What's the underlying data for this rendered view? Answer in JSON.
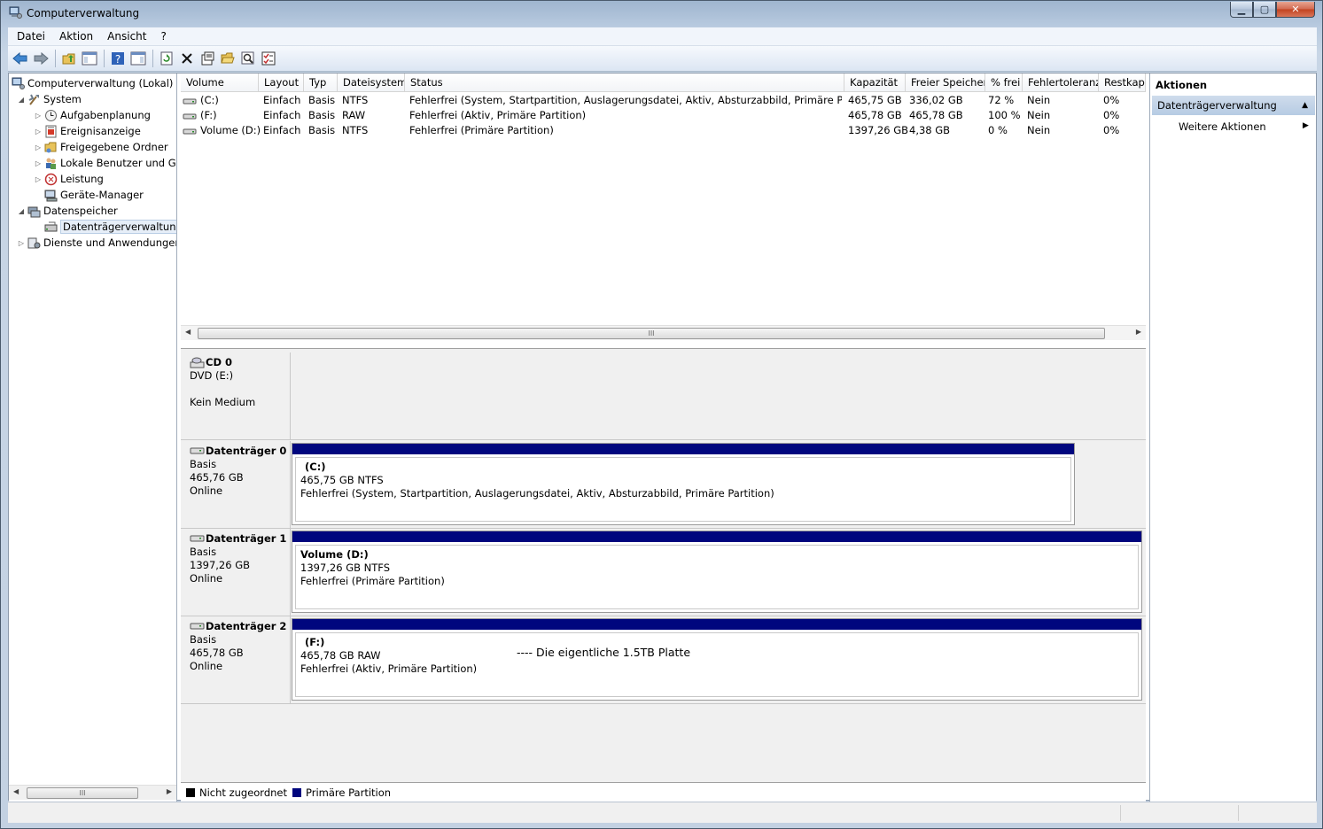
{
  "window": {
    "title": "Computerverwaltung"
  },
  "menu": [
    "Datei",
    "Aktion",
    "Ansicht",
    "?"
  ],
  "tree": {
    "root": "Computerverwaltung (Lokal)",
    "system": "System",
    "aufgaben": "Aufgabenplanung",
    "ereignis": "Ereignisanzeige",
    "freigegeben": "Freigegebene Ordner",
    "benutzer": "Lokale Benutzer und Gr",
    "leistung": "Leistung",
    "geraete": "Geräte-Manager",
    "speicher": "Datenspeicher",
    "datentraeger": "Datenträgerverwaltung",
    "dienste": "Dienste und Anwendungen",
    "scroll_thumb": "III"
  },
  "list": {
    "headers": [
      "Volume",
      "Layout",
      "Typ",
      "Dateisystem",
      "Status",
      "Kapazität",
      "Freier Speicher",
      "% frei",
      "Fehlertoleranz",
      "Restkapa"
    ],
    "rows": [
      [
        "(C:)",
        "Einfach",
        "Basis",
        "NTFS",
        "Fehlerfrei (System, Startpartition, Auslagerungsdatei, Aktiv, Absturzabbild, Primäre Partition)",
        "465,75 GB",
        "336,02 GB",
        "72 %",
        "Nein",
        "0%"
      ],
      [
        "(F:)",
        "Einfach",
        "Basis",
        "RAW",
        "Fehlerfrei (Aktiv, Primäre Partition)",
        "465,78 GB",
        "465,78 GB",
        "100 %",
        "Nein",
        "0%"
      ],
      [
        "Volume (D:)",
        "Einfach",
        "Basis",
        "NTFS",
        "Fehlerfrei (Primäre Partition)",
        "1397,26 GB",
        "4,38 GB",
        "0 %",
        "Nein",
        "0%"
      ]
    ],
    "scroll_thumb": "III"
  },
  "disks": {
    "cd": {
      "name": "CD 0",
      "line1": "DVD (E:)",
      "line2": "Kein Medium"
    },
    "d0": {
      "name": "Datenträger 0",
      "type": "Basis",
      "size": "465,76 GB",
      "state": "Online",
      "part_name": "(C:)",
      "part_size": "465,75 GB NTFS",
      "part_status": "Fehlerfrei (System, Startpartition, Auslagerungsdatei, Aktiv, Absturzabbild, Primäre Partition)"
    },
    "d1": {
      "name": "Datenträger 1",
      "type": "Basis",
      "size": "1397,26 GB",
      "state": "Online",
      "part_name": "Volume  (D:)",
      "part_size": "1397,26 GB NTFS",
      "part_status": "Fehlerfrei (Primäre Partition)"
    },
    "d2": {
      "name": "Datenträger 2",
      "type": "Basis",
      "size": "465,78 GB",
      "state": "Online",
      "part_name": "(F:)",
      "part_size": "465,78 GB RAW",
      "part_status": "Fehlerfrei (Aktiv, Primäre Partition)",
      "annotation": "---- Die eigentliche 1.5TB Platte"
    }
  },
  "legend": {
    "unallocated": "Nicht zugeordnet",
    "primary": "Primäre Partition"
  },
  "actions": {
    "title": "Aktionen",
    "section": "Datenträgerverwaltung",
    "more": "Weitere Aktionen"
  },
  "colors": {
    "primary_partition": "#00067e",
    "unallocated": "#000000"
  }
}
